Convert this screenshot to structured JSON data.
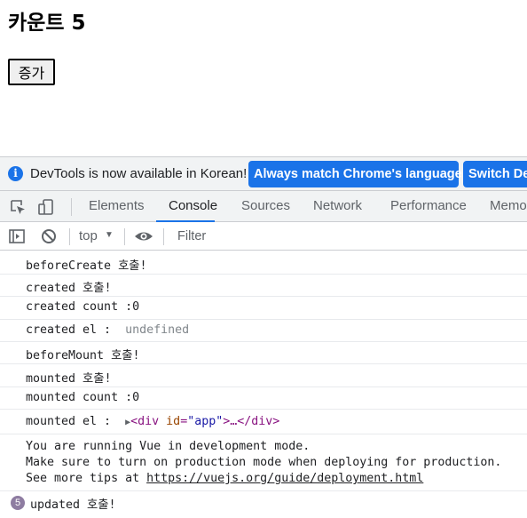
{
  "page": {
    "heading": "카운트 5",
    "button_label": "증가"
  },
  "devtools": {
    "infobar": {
      "message": "DevTools is now available in Korean!",
      "match_button": "Always match Chrome's language",
      "switch_button": "Switch De"
    },
    "tabs": [
      {
        "label": "Elements",
        "active": false
      },
      {
        "label": "Console",
        "active": true
      },
      {
        "label": "Sources",
        "active": false
      },
      {
        "label": "Network",
        "active": false
      },
      {
        "label": "Performance",
        "active": false
      },
      {
        "label": "Memo",
        "active": false
      }
    ],
    "toolbar": {
      "context": "top",
      "filter_placeholder": "Filter"
    },
    "console": {
      "messages": [
        {
          "text": "beforeCreate 호출!"
        },
        {
          "text": "created 호출!"
        },
        {
          "text": "created count :0"
        },
        {
          "label": "created el :",
          "value": "undefined"
        },
        {
          "text": "beforeMount 호출!"
        },
        {
          "text": "mounted 호출!"
        },
        {
          "text": "mounted count :0"
        },
        {
          "label": "mounted el :",
          "element": {
            "open": "<div",
            "attr": "id",
            "value": "\"app\"",
            "close": ">…</div>"
          }
        },
        {
          "lines": [
            "You are running Vue in development mode.",
            "Make sure to turn on production mode when deploying for production."
          ],
          "prefix": "See more tips at ",
          "link": "https://vuejs.org/guide/deployment.html"
        },
        {
          "text": "updated 호출!",
          "repeat_count": "5"
        }
      ]
    }
  },
  "colors": {
    "accent": "#1a73e8",
    "repeat_badge": "#8e7ca1"
  },
  "icons": [
    "info-icon",
    "inspect-element-icon",
    "device-toggle-icon",
    "sidebar-toggle-icon",
    "clear-console-icon",
    "eye-icon"
  ]
}
